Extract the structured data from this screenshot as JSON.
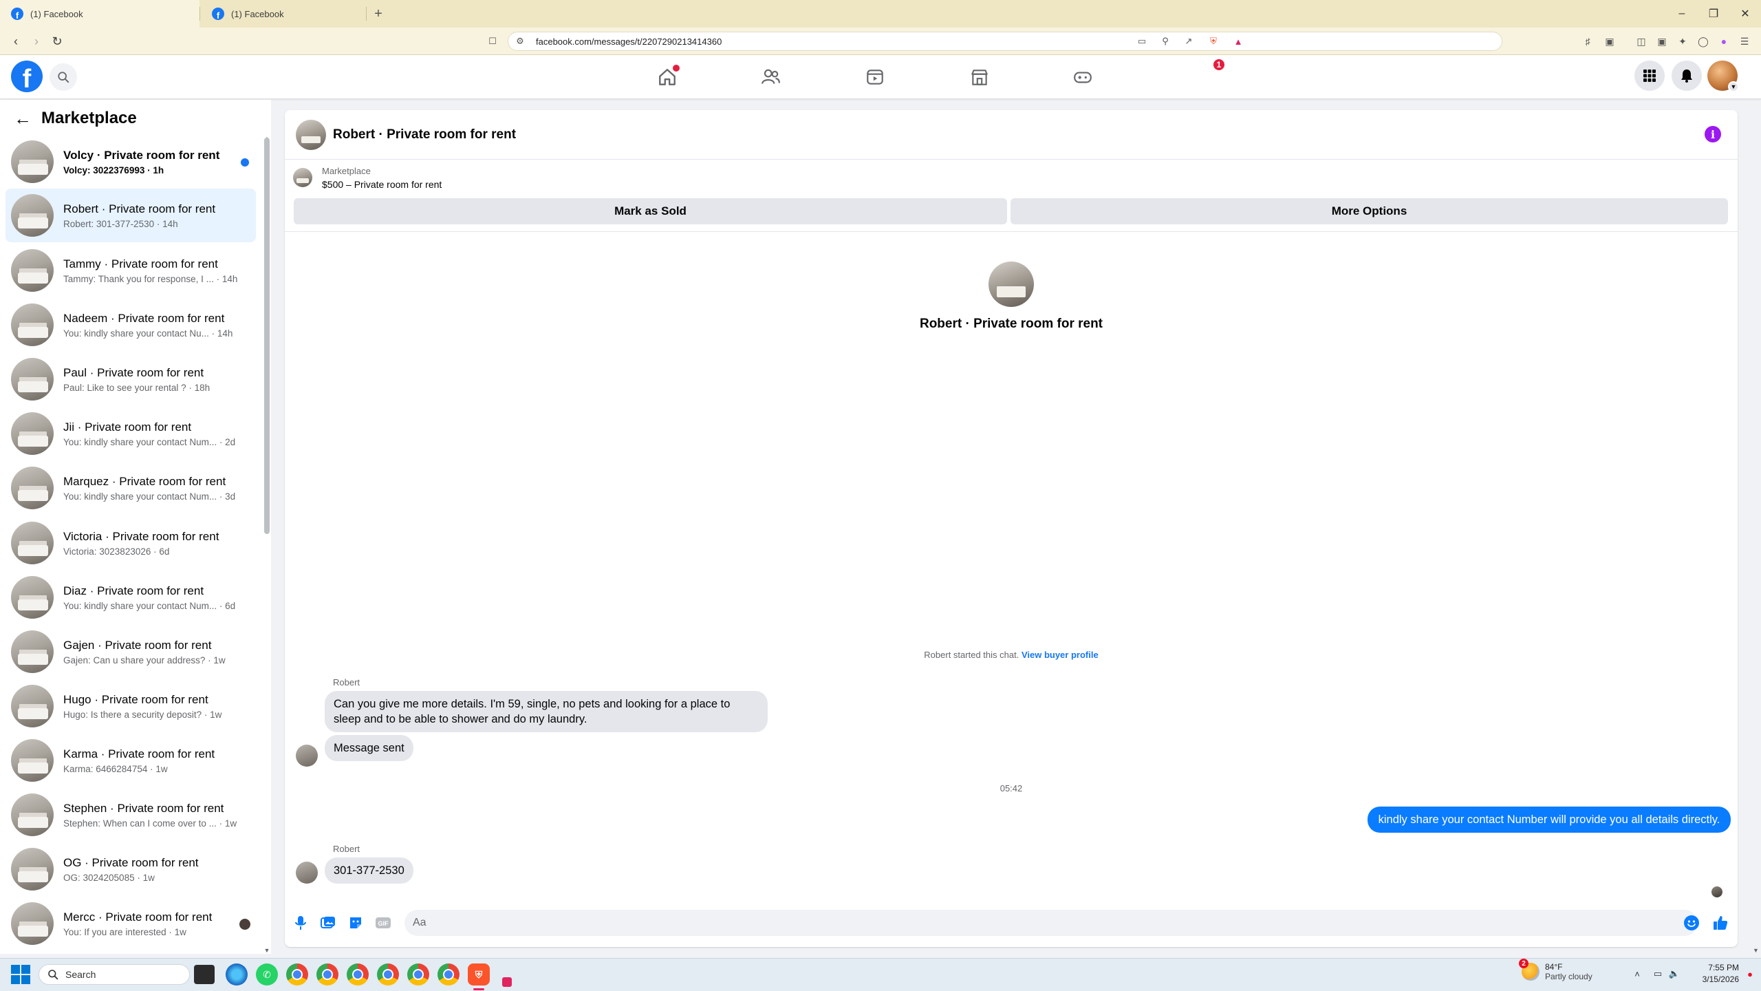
{
  "browser": {
    "tabs": [
      {
        "title": "(1) Facebook",
        "active": true
      },
      {
        "title": "(1) Facebook",
        "active": false
      }
    ],
    "url": "facebook.com/messages/t/2207290213414360"
  },
  "fb_nav": {
    "notification_count": "1",
    "icons": [
      "home-icon",
      "friends-icon",
      "video-icon",
      "marketplace-icon",
      "gaming-icon"
    ]
  },
  "sidebar": {
    "title": "Marketplace",
    "conversations": [
      {
        "title": "Volcy · Private room for rent",
        "preview": "Volcy: 3022376993 · 1h",
        "unread": true
      },
      {
        "title": "Robert · Private room for rent",
        "preview": "Robert: 301-377-2530 · 14h",
        "selected": true
      },
      {
        "title": "Tammy · Private room for rent",
        "preview": "Tammy: Thank you for response, I ... · 14h"
      },
      {
        "title": "Nadeem · Private room for rent",
        "preview": "You: kindly share your contact Nu... · 14h"
      },
      {
        "title": "Paul · Private room for rent",
        "preview": "Paul: Like to see your rental ? · 18h"
      },
      {
        "title": "Jii · Private room for rent",
        "preview": "You: kindly share your contact Num... · 2d"
      },
      {
        "title": "Marquez · Private room for rent",
        "preview": "You: kindly share your contact Num... · 3d"
      },
      {
        "title": "Victoria · Private room for rent",
        "preview": "Victoria: 3023823026 · 6d"
      },
      {
        "title": "Diaz · Private room for rent",
        "preview": "You: kindly share your contact Num... · 6d"
      },
      {
        "title": "Gajen · Private room for rent",
        "preview": "Gajen: Can u share your address? · 1w"
      },
      {
        "title": "Hugo · Private room for rent",
        "preview": "Hugo: Is there a security deposit? · 1w"
      },
      {
        "title": "Karma · Private room for rent",
        "preview": "Karma: 6466284754 · 1w"
      },
      {
        "title": "Stephen · Private room for rent",
        "preview": "Stephen: When can I come over to ... · 1w"
      },
      {
        "title": "OG · Private room for rent",
        "preview": "OG: 3024205085 · 1w"
      },
      {
        "title": "Mercc · Private room for rent",
        "preview": "You: If you are interested · 1w",
        "seen": true
      }
    ]
  },
  "chat": {
    "title": "Robert · Private room for rent",
    "listing_label": "Marketplace",
    "listing_price": "$500 – Private room for rent",
    "mark_sold_label": "Mark as Sold",
    "more_options_label": "More Options",
    "center_name": "Robert · Private room for rent",
    "started_text": "Robert started this chat.",
    "view_profile_label": "View buyer profile",
    "messages": {
      "sender1": "Robert",
      "msg1": "Can you give me more details. I'm 59, single, no pets and looking for a place to sleep and to be able to shower and do my laundry.",
      "msg2": "Message sent",
      "timestamp": "05:42",
      "outgoing": "kindly share your contact Number will provide you all details directly.",
      "sender2": "Robert",
      "msg3": "301-377-2530"
    },
    "composer_placeholder": "Aa"
  },
  "taskbar": {
    "search_label": "Search",
    "weather_temp": "84°F",
    "weather_desc": "Partly cloudy",
    "weather_badge": "2",
    "time": "7:55 PM",
    "date": "3/15/2026"
  },
  "colors": {
    "fb_blue": "#1877f2",
    "outgoing_bubble": "#0a7cff",
    "info_purple": "#9b18f0",
    "selected_row": "#e7f3ff"
  }
}
